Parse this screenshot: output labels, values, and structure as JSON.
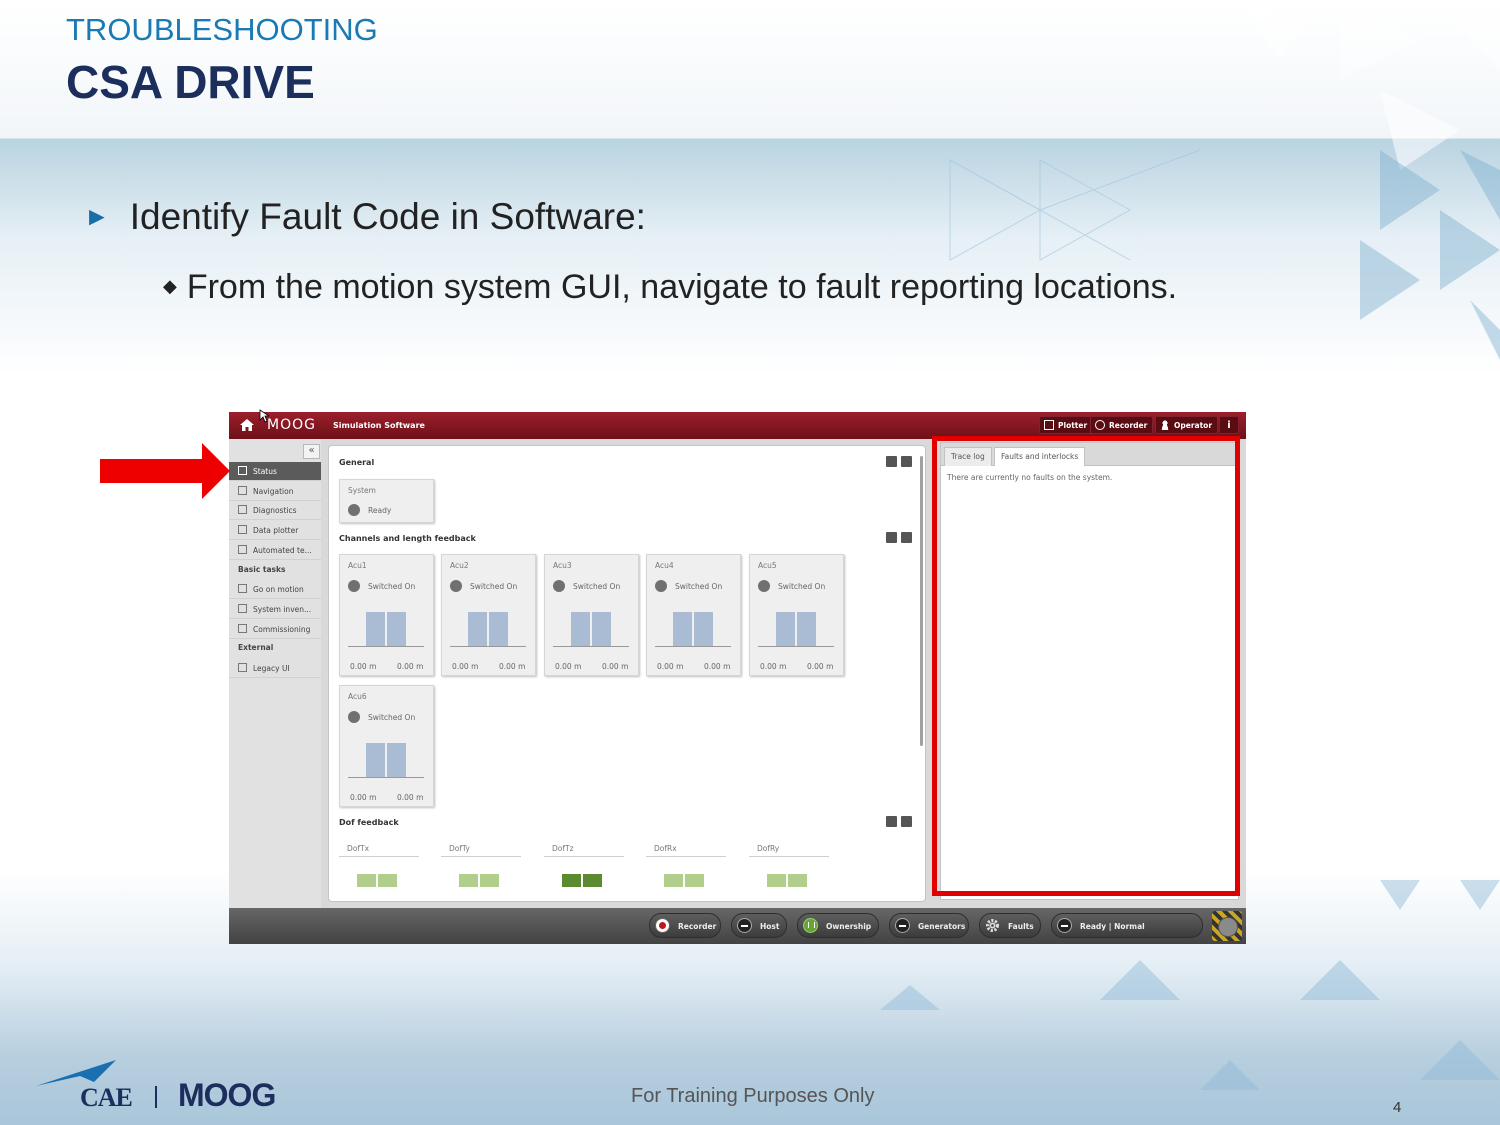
{
  "slide": {
    "kicker": "TROUBLESHOOTING",
    "title": "CSA DRIVE",
    "bullet_main": "Identify Fault Code in Software:",
    "bullet_sub": "From the motion system GUI, navigate to fault reporting locations.",
    "footer": "For Training Purposes Only",
    "page_number": "4",
    "logos": {
      "cae": "CAE",
      "moog": "MOOG"
    }
  },
  "app": {
    "brand": "MOOG",
    "title": "Simulation Software",
    "topbar_buttons": {
      "plotter": "Plotter",
      "recorder": "Recorder",
      "operator": "Operator",
      "info": "i"
    },
    "collapse_glyph": "«",
    "sidebar": {
      "status": "Status",
      "navigation": "Navigation",
      "diagnostics": "Diagnostics",
      "data_plotter": "Data plotter",
      "automated": "Automated te...",
      "basic_tasks": "Basic tasks",
      "go_on_motion": "Go on motion",
      "system_inventory": "System inven...",
      "commissioning": "Commissioning",
      "external": "External",
      "legacy_ui": "Legacy UI"
    },
    "general": {
      "title": "General",
      "system_name": "System",
      "system_state": "Ready"
    },
    "channels": {
      "title": "Channels and length feedback",
      "cards": [
        {
          "name": "Acu1",
          "state": "Switched On",
          "v1": "0.00 m",
          "v2": "0.00 m"
        },
        {
          "name": "Acu2",
          "state": "Switched On",
          "v1": "0.00 m",
          "v2": "0.00 m"
        },
        {
          "name": "Acu3",
          "state": "Switched On",
          "v1": "0.00 m",
          "v2": "0.00 m"
        },
        {
          "name": "Acu4",
          "state": "Switched On",
          "v1": "0.00 m",
          "v2": "0.00 m"
        },
        {
          "name": "Acu5",
          "state": "Switched On",
          "v1": "0.00 m",
          "v2": "0.00 m"
        },
        {
          "name": "Acu6",
          "state": "Switched On",
          "v1": "0.00 m",
          "v2": "0.00 m"
        }
      ]
    },
    "dof": {
      "title": "Dof feedback",
      "items": [
        "DofTx",
        "DofTy",
        "DofTz",
        "DofRx",
        "DofRy"
      ]
    },
    "right_panel": {
      "tabs": [
        "Trace log",
        "Faults and interlocks"
      ],
      "message": "There are currently no faults on the system."
    },
    "statusbar": {
      "recorder": "Recorder",
      "host": "Host",
      "ownership": "Ownership",
      "generators": "Generators",
      "faults": "Faults",
      "state": "Ready | Normal"
    }
  },
  "colors": {
    "title_navy": "#1b2e5c",
    "kicker_blue": "#1a7ab3",
    "topbar_red": "#8e1b27",
    "highlight_red": "#e00000"
  }
}
